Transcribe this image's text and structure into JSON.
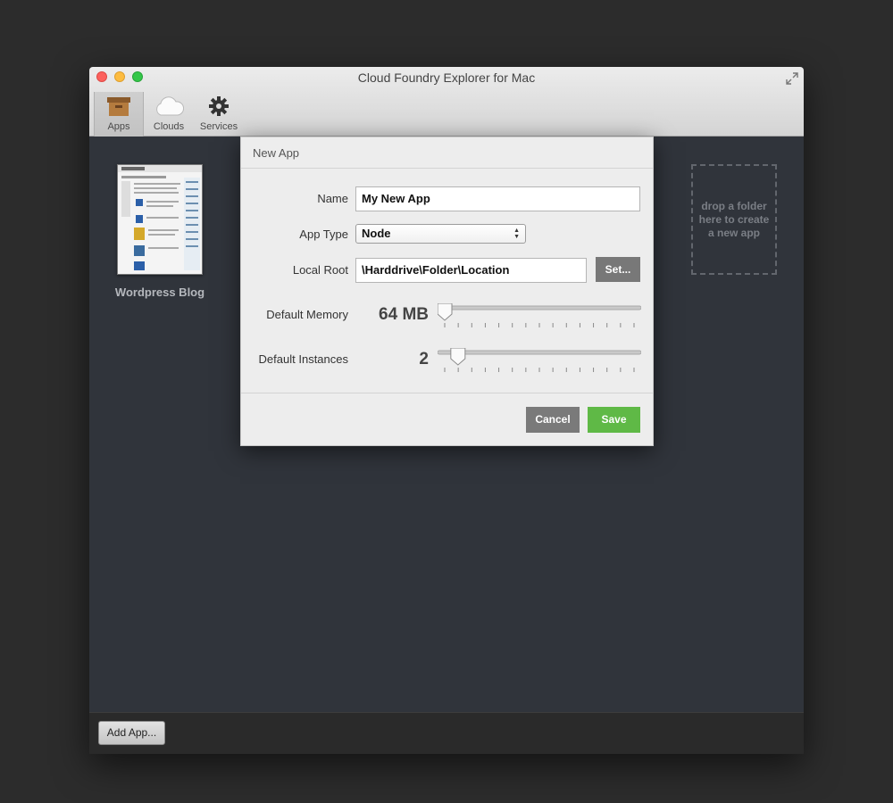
{
  "window": {
    "title": "Cloud Foundry Explorer for Mac"
  },
  "toolbar": {
    "apps_label": "Apps",
    "clouds_label": "Clouds",
    "services_label": "Services"
  },
  "apps": [
    {
      "name": "Wordpress Blog"
    }
  ],
  "dropzone": {
    "line1": "drop a folder",
    "line2": "here to create",
    "line3": "a new app"
  },
  "bottom": {
    "add_label": "Add App..."
  },
  "dialog": {
    "title": "New App",
    "name_label": "Name",
    "name_value": "My New App",
    "type_label": "App Type",
    "type_value": "Node",
    "root_label": "Local Root",
    "root_value": "\\Harddrive\\Folder\\Location",
    "set_label": "Set...",
    "memory_label": "Default Memory",
    "memory_value": "64 MB",
    "memory_fraction": 0.0,
    "instances_label": "Default Instances",
    "instances_value": "2",
    "instances_fraction": 0.07,
    "cancel_label": "Cancel",
    "save_label": "Save"
  },
  "colors": {
    "save": "#5fb946",
    "dialog_bg": "#ededed",
    "content_bg": "#30343b"
  }
}
